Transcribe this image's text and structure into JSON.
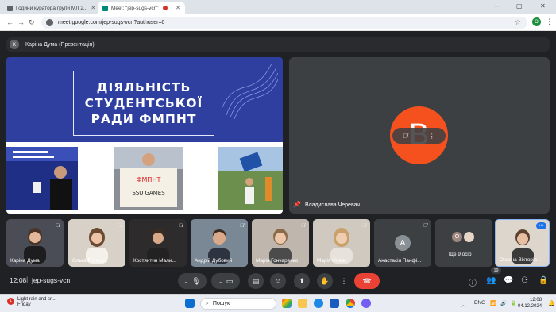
{
  "browser": {
    "tabs": [
      {
        "title": "Години куратора групи МЛ 2...",
        "active": false
      },
      {
        "title": "Meet: \"jep-sugs-vcn\"",
        "active": true
      }
    ],
    "new_tab": "+",
    "url": "meet.google.com/jep-sugs-vcn?authuser=0",
    "profile_initial": "O"
  },
  "presenter_bar": {
    "initial": "K",
    "text": "Каріна Дума (Презентація)"
  },
  "slide": {
    "title_lines": [
      "ДІЯЛЬНІСТЬ",
      "СТУДЕНТСЬКОЇ",
      "РАДИ ФМПНТ"
    ]
  },
  "main_tile": {
    "initial": "В",
    "name": "Владислава Черевач"
  },
  "participants": [
    {
      "name": "Каріна Дума",
      "muted": true
    },
    {
      "name": "Ольга Поліщук",
      "muted": true
    },
    {
      "name": "Костянтин Мали...",
      "muted": true
    },
    {
      "name": "Андрій Дубовий",
      "muted": true
    },
    {
      "name": "Марія Гончаренко",
      "muted": true
    },
    {
      "name": "Марія Новак",
      "muted": true
    },
    {
      "name": "Анастасія Панфі...",
      "muted": true,
      "initial": "А"
    },
    {
      "name": "Ще 9 осіб",
      "initial": "О"
    },
    {
      "name": "Оксана Вікторія...",
      "muted": false
    }
  ],
  "controls": {
    "time": "12:08",
    "separator": "|",
    "meeting_code": "jep-sugs-vcn",
    "people_count": "19"
  },
  "taskbar": {
    "weather_line1": "Light rain and sn...",
    "weather_line2": "Friday",
    "weather_badge": "1",
    "search_label": "Пошук",
    "lang": "ENG",
    "clock_time": "12:08",
    "clock_date": "04.12.2024"
  },
  "colors": {
    "meet_bg": "#202124",
    "tile_bg": "#3c4043",
    "slide_blue": "#2e3fa0",
    "avatar_orange": "#f4511e",
    "hangup_red": "#ea4335"
  }
}
